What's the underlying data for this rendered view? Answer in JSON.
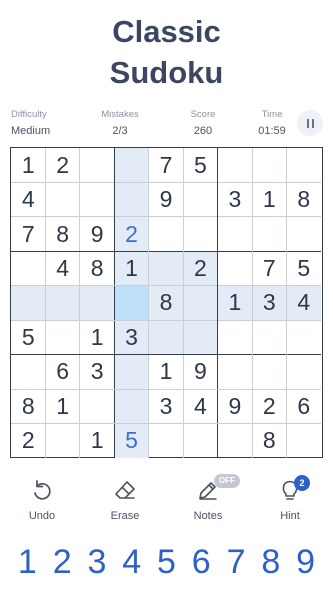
{
  "title": {
    "line1": "Classic",
    "line2": "Sudoku"
  },
  "stats": {
    "difficulty": {
      "label": "Difficulty",
      "value": "Medium"
    },
    "mistakes": {
      "label": "Mistakes",
      "value": "2/3"
    },
    "score": {
      "label": "Score",
      "value": "260"
    },
    "time": {
      "label": "Time",
      "value": "01:59"
    }
  },
  "pause_icon": "pause-icon",
  "grid": [
    [
      "1",
      "2",
      "",
      "",
      "7",
      "5",
      "",
      "",
      ""
    ],
    [
      "4",
      "",
      "",
      "",
      "9",
      "",
      "3",
      "1",
      "8"
    ],
    [
      "7",
      "8",
      "9",
      "2",
      "",
      "",
      "",
      "",
      ""
    ],
    [
      "",
      "4",
      "8",
      "1",
      "",
      "2",
      "",
      "7",
      "5"
    ],
    [
      "",
      "",
      "",
      "",
      "8",
      "",
      "1",
      "3",
      "4"
    ],
    [
      "5",
      "",
      "1",
      "3",
      "",
      "",
      "",
      "",
      ""
    ],
    [
      "",
      "6",
      "3",
      "",
      "1",
      "9",
      "",
      "",
      ""
    ],
    [
      "8",
      "1",
      "",
      "",
      "3",
      "4",
      "9",
      "2",
      "6"
    ],
    [
      "2",
      "",
      "1",
      "5",
      "",
      "",
      "",
      "8",
      ""
    ]
  ],
  "user_entries": [
    [
      2,
      3
    ],
    [
      8,
      3
    ]
  ],
  "selected": [
    4,
    3
  ],
  "tools": {
    "undo": {
      "label": "Undo",
      "icon": "undo-icon"
    },
    "erase": {
      "label": "Erase",
      "icon": "eraser-icon"
    },
    "notes": {
      "label": "Notes",
      "icon": "pencil-icon",
      "badge": "OFF"
    },
    "hint": {
      "label": "Hint",
      "icon": "lightbulb-icon",
      "badge": "2"
    }
  },
  "numpad": [
    "1",
    "2",
    "3",
    "4",
    "5",
    "6",
    "7",
    "8",
    "9"
  ],
  "colors": {
    "accent": "#2d61c9",
    "highlight": "#e3ebf6",
    "selected": "#bfe0fb",
    "title": "#3d4660"
  }
}
